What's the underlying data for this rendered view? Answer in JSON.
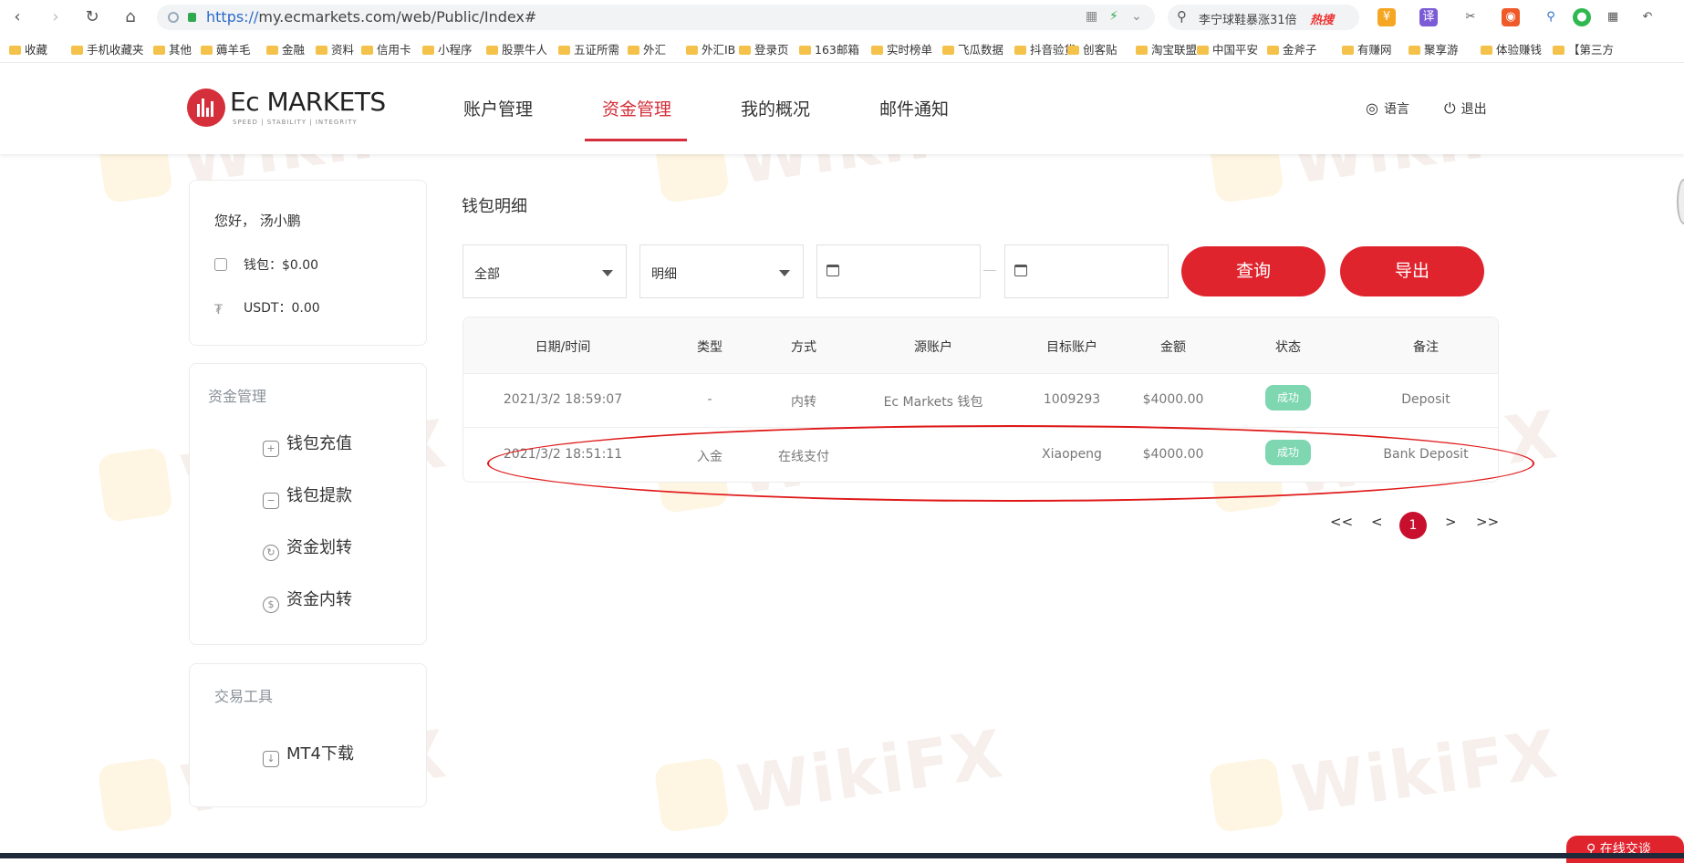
{
  "browser": {
    "url_scheme": "https://",
    "url_host": "my.ecmarkets.com",
    "url_path": "/web/Public/Index#",
    "search_text": "李宁球鞋暴涨31倍",
    "search_hot": "热搜"
  },
  "bookmarks": [
    "收藏",
    "手机收藏夹",
    "其他",
    "薅羊毛",
    "金融",
    "资料",
    "信用卡",
    "小程序",
    "股票牛人",
    "五证所需",
    "外汇",
    "外汇IB",
    "登录页",
    "163邮箱",
    "实时榜单",
    "飞瓜数据",
    "抖音验货",
    "创客贴",
    "淘宝联盟",
    "中国平安",
    "金斧子",
    "有赚网",
    "聚享游",
    "体验赚钱",
    "【第三方"
  ],
  "header": {
    "brand": "Ec MARKETS",
    "tagline": "SPEED | STABILITY | INTEGRITY",
    "nav": [
      "账户管理",
      "资金管理",
      "我的概况",
      "邮件通知"
    ],
    "language": "语言",
    "logout": "退出"
  },
  "sidebar": {
    "greeting": "您好， 汤小鹏",
    "wallet": "钱包：$0.00",
    "usdt": "USDT：0.00",
    "funds_title": "资金管理",
    "funds_menu": [
      "钱包充值",
      "钱包提款",
      "资金划转",
      "资金内转"
    ],
    "tools_title": "交易工具",
    "tools_menu": [
      "MT4下载"
    ]
  },
  "main": {
    "title": "钱包明细",
    "filter_type": "全部",
    "filter_mode": "明细",
    "query_button": "查询",
    "export_button": "导出",
    "columns": [
      "日期/时间",
      "类型",
      "方式",
      "源账户",
      "目标账户",
      "金额",
      "状态",
      "备注"
    ],
    "rows": [
      {
        "datetime": "2021/3/2 18:59:07",
        "type": "-",
        "method": "内转",
        "source": "Ec Markets 钱包",
        "target": "1009293",
        "amount": "$4000.00",
        "status": "成功",
        "note": "Deposit"
      },
      {
        "datetime": "2021/3/2 18:51:11",
        "type": "入金",
        "method": "在线支付",
        "source": "",
        "target": "Xiaopeng",
        "amount": "$4000.00",
        "status": "成功",
        "note": "Bank Deposit"
      }
    ],
    "pager": {
      "first": "<<",
      "prev": "<",
      "current": "1",
      "next": ">",
      "last": ">>"
    }
  },
  "watermark": "WikiFX",
  "chat": "在线交谈",
  "colors": {
    "brand_red": "#e0242e",
    "success": "#7ed7b1",
    "annotation": "#e01818"
  }
}
